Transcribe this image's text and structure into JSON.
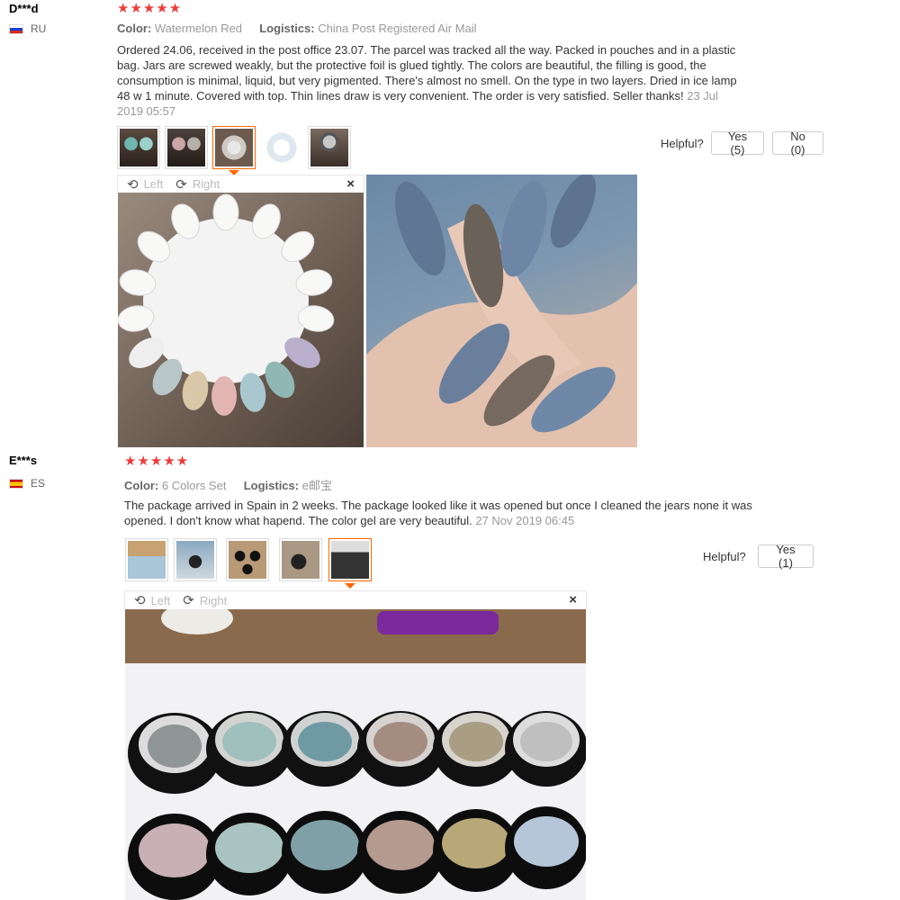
{
  "reviews": [
    {
      "user": "D***d",
      "country": "RU",
      "stars": "★★★★★",
      "color_label": "Color:",
      "color_value": "Watermelon Red",
      "logistics_label": "Logistics:",
      "logistics_value": "China Post Registered Air Mail",
      "text": "Ordered 24.06, received in the post office 23.07. The parcel was tracked all the way. Packed in pouches and in a plastic bag. Jars are screwed weakly, but the protective foil is glued tightly. The colors are beautiful, the filling is good, the consumption is minimal, liquid, but very pigmented. There's almost no smell. On the type in two layers. Dried in ice lamp 48 w 1 minute. Covered with top. Thin lines draw is very convenient. The order is very satisfied. Seller thanks!",
      "date": "23 Jul 2019 05:57",
      "helpful_label": "Helpful?",
      "yes_label": "Yes (5)",
      "no_label": "No (0)",
      "viewer_left": "Left",
      "viewer_right": "Right",
      "viewer_close": "×"
    },
    {
      "user": "E***s",
      "country": "ES",
      "stars": "★★★★★",
      "color_label": "Color:",
      "color_value": "6 Colors Set",
      "logistics_label": "Logistics:",
      "logistics_value": "e邮宝",
      "text": "The package arrived in Spain in 2 weeks. The package looked like it was opened but once I cleaned the jears none it was opened. I don't know what hapend. The color gel are very beautiful.",
      "date": "27 Nov 2019 06:45",
      "helpful_label": "Helpful?",
      "yes_label": "Yes (1)",
      "viewer_left": "Left",
      "viewer_right": "Right",
      "viewer_close": "×"
    }
  ],
  "icons": {
    "rotate_left": "⟲",
    "rotate_right": "⟳"
  },
  "colors": {
    "star": "#f03c3c",
    "active_border": "#ff6600",
    "meta_gray": "#999999"
  }
}
